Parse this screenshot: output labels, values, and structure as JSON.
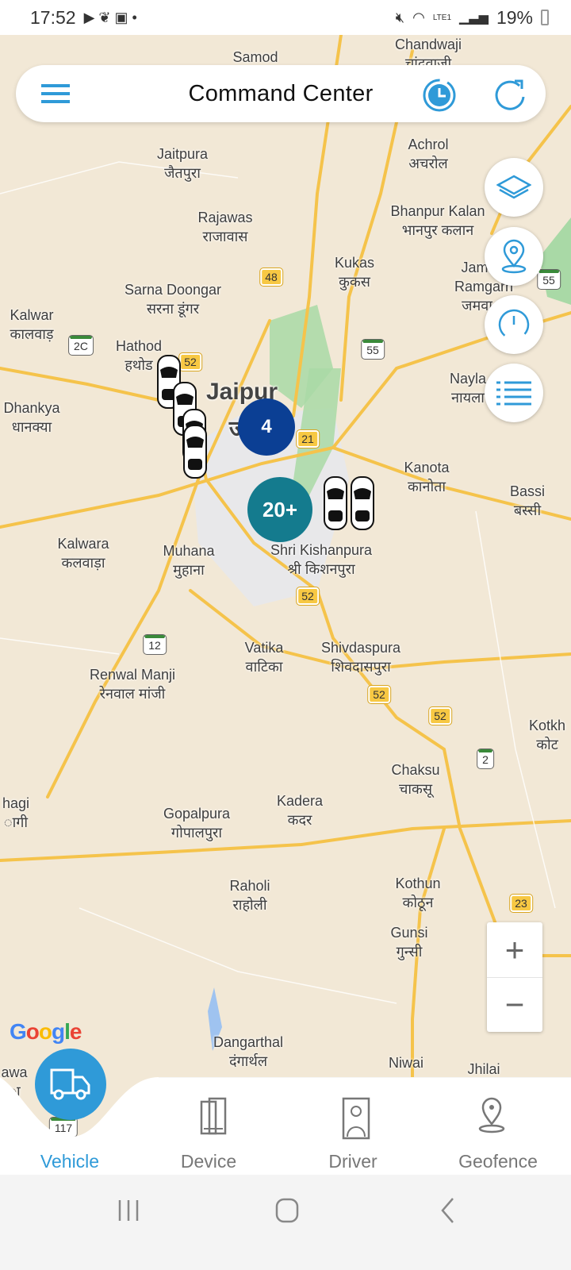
{
  "status_bar": {
    "time": "17:52",
    "battery": "19%",
    "network": "LTE1"
  },
  "header": {
    "title": "Command Center",
    "menu_icon": "menu-icon",
    "history_icon": "clock-history-icon",
    "refresh_icon": "refresh-icon"
  },
  "map": {
    "places": [
      "Chandwaji",
      "चांदवाजी",
      "Samod",
      "Jaitpura",
      "जैतपुरा",
      "Achrol",
      "अचरोल",
      "Rajawas",
      "राजावास",
      "Bhanpur Kalan",
      "भानपुर कलान",
      "Kukas",
      "कुकस",
      "Sarna Doongar",
      "सरना डूंगर",
      "Jamwa",
      "Ramgarh",
      "जमवा रा",
      "Kalwar",
      "कालवाड़",
      "Hathod",
      "हथोड",
      "Nayla",
      "नायला",
      "Dhankya",
      "धानक्या",
      "Jaipur",
      "ज",
      "Kanota",
      "कानोता",
      "Bassi",
      "बस्सी",
      "Kalwara",
      "कलवाड़ा",
      "Muhana",
      "मुहाना",
      "Shri Kishanpura",
      "श्री किशनपुरा",
      "Vatika",
      "वाटिका",
      "Shivdaspura",
      "शिवदासपुरा",
      "Renwal Manji",
      "रेनवाल मांजी",
      "Kotkh",
      "कोट",
      "Chaksu",
      "चाकसू",
      "hagi",
      "ागी",
      "Kadera",
      "कदर",
      "Gopalpura",
      "गोपालपुरा",
      "Raholi",
      "राहोली",
      "Kothun",
      "कोठून",
      "Gunsi",
      "गुन्सी",
      "Dangarthal",
      "दंगार्थल",
      "Niwai",
      "Jhilai",
      "awa",
      "ा"
    ],
    "shields": [
      "48",
      "2C",
      "52",
      "55",
      "21",
      "52",
      "12",
      "52",
      "52",
      "2",
      "23",
      "55",
      "117"
    ],
    "clusters": [
      {
        "count": "4",
        "color": "#0b3f94"
      },
      {
        "count": "20+",
        "color": "#147b8e"
      }
    ],
    "attribution": "Google",
    "zoom_in": "+",
    "zoom_out": "−"
  },
  "side_buttons": [
    "layers-icon",
    "location-pin-icon",
    "speedometer-icon",
    "list-icon"
  ],
  "bottom_nav": {
    "items": [
      {
        "label": "Vehicle",
        "icon": "truck-icon",
        "active": true
      },
      {
        "label": "Device",
        "icon": "device-icon"
      },
      {
        "label": "Driver",
        "icon": "driver-icon"
      },
      {
        "label": "Geofence",
        "icon": "geofence-icon"
      }
    ],
    "active_color": "#2f9ad8"
  }
}
